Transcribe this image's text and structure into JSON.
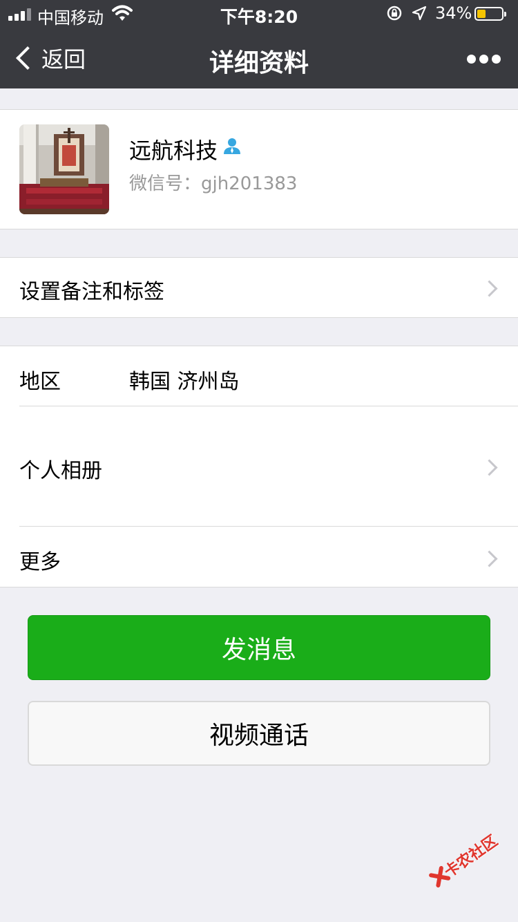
{
  "status_bar": {
    "carrier": "中国移动",
    "time": "下午8:20",
    "battery_percent": "34%",
    "battery_level": 0.34,
    "battery_color": "#F5C400"
  },
  "nav": {
    "back_label": "返回",
    "title": "详细资料",
    "more_icon": "more-dots-icon"
  },
  "profile": {
    "name": "远航科技",
    "wechat_id": "微信号：gjh201383",
    "avatar_icon": "church-photo-avatar",
    "badge_icon": "person-icon"
  },
  "remark_row": {
    "label": "设置备注和标签"
  },
  "info": {
    "region_label": "地区",
    "region_value": "韩国 济州岛",
    "album_label": "个人相册",
    "more_label": "更多"
  },
  "actions": {
    "send_message": "发消息",
    "video_call": "视频通话",
    "accent": "#1AAD19"
  },
  "watermark": {
    "text": "卡农社区"
  }
}
